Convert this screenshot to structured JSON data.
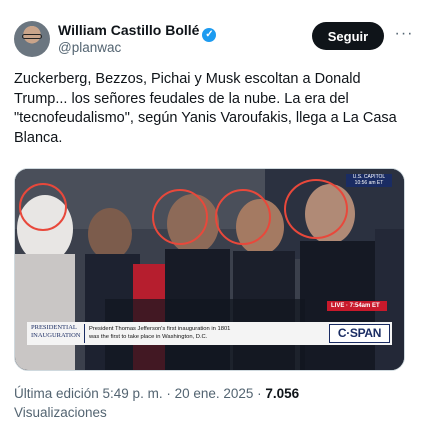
{
  "author": {
    "name": "William Castillo Bollé",
    "handle": "@planwac",
    "verified_icon": "verified-badge-icon"
  },
  "actions": {
    "follow_label": "Seguir",
    "more_label": "···"
  },
  "tweet": {
    "text": "Zuckerberg, Bezzos, Pichai y Musk escoltan a Donald Trump... los señores feudales de la nube.  La era del \"tecnofeudalismo\", según Yanis Varoufakis, llega a La Casa Blanca."
  },
  "media": {
    "live_label": "LIVE · 7:54am ET",
    "capitol_label": "U.S. CAPITOL",
    "capitol_time": "10:56 am ET",
    "chyron_left_line1": "PRESIDENTIAL",
    "chyron_left_line2": "INAUGURATION",
    "chyron_text_line1": "President Thomas Jefferson's first inauguration in 1801",
    "chyron_text_line2": "was the first to take place in Washington, D.C.",
    "network_logo": "C·SPAN"
  },
  "meta": {
    "edited": "Última edición 5:49 p. m. · 20 ene. 2025 · ",
    "views_count": "7.056",
    "views_label": "Visualizaciones"
  },
  "colors": {
    "follow_bg": "#0f1419",
    "verified": "#1d9bf0",
    "circle_highlight": "#e8483b",
    "secondary_text": "#536471"
  }
}
